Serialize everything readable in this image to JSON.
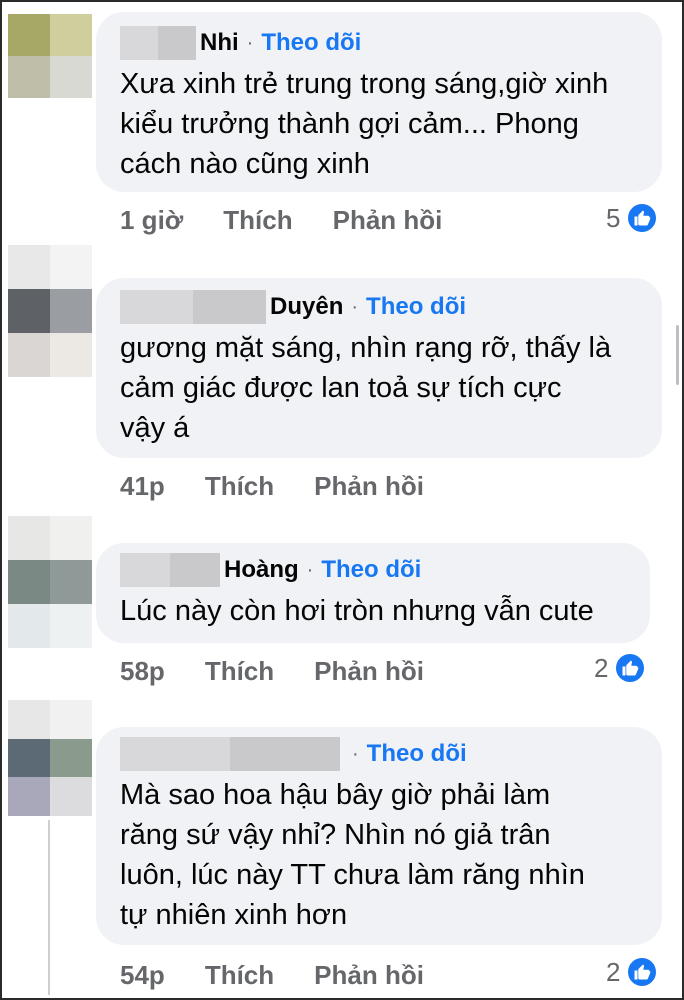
{
  "comments": [
    {
      "name": "Nhi",
      "follow": "Theo dõi",
      "dot": "·",
      "text": "Xưa xinh trẻ trung trong sáng,giờ xinh\nkiểu trưởng thành gợi cảm... Phong\ncách nào cũng xinh",
      "time": "1 giờ",
      "like_label": "Thích",
      "reply_label": "Phản hồi",
      "reactions": "5",
      "avatar_colors": [
        "#a7a766",
        "#cfcf9d",
        "#bfbfa9",
        "#d9d9d4"
      ]
    },
    {
      "name": "Duyên",
      "follow": "Theo dõi",
      "dot": "·",
      "text": "gương mặt sáng, nhìn rạng rỡ, thấy là\ncảm giác được lan toả sự tích cực\nvậy á",
      "time": "41p",
      "like_label": "Thích",
      "reply_label": "Phản hồi",
      "reactions": "",
      "avatar_colors": [
        "#5e6166",
        "#9a9da1",
        "#d9d6d4",
        "#ece9e5"
      ]
    },
    {
      "name": "Hoàng",
      "follow": "Theo dõi",
      "dot": "·",
      "text": "Lúc này còn hơi tròn nhưng vẫn cute",
      "time": "58p",
      "like_label": "Thích",
      "reply_label": "Phản hồi",
      "reactions": "2",
      "avatar_colors": [
        "#7b8985",
        "#8f9a98",
        "#e3e8ea",
        "#eef1f2"
      ]
    },
    {
      "name": "",
      "follow": "Theo dõi",
      "dot": "·",
      "text": "Mà sao hoa hậu bây giờ phải làm\nrăng sứ vậy nhỉ? Nhìn nó giả trân\nluôn, lúc này TT chưa làm răng nhìn\ntự nhiên xinh hơn",
      "time": "54p",
      "like_label": "Thích",
      "reply_label": "Phản hồi",
      "reactions": "2",
      "avatar_colors": [
        "#5c6a76",
        "#8a9a8c",
        "#a9a8bb",
        "#dcdcde"
      ]
    }
  ],
  "colors": {
    "accent": "#1877f2",
    "bubble": "#f0f2f5",
    "muted": "#65676b"
  },
  "icons": {
    "reaction": "like-thumb-icon"
  }
}
